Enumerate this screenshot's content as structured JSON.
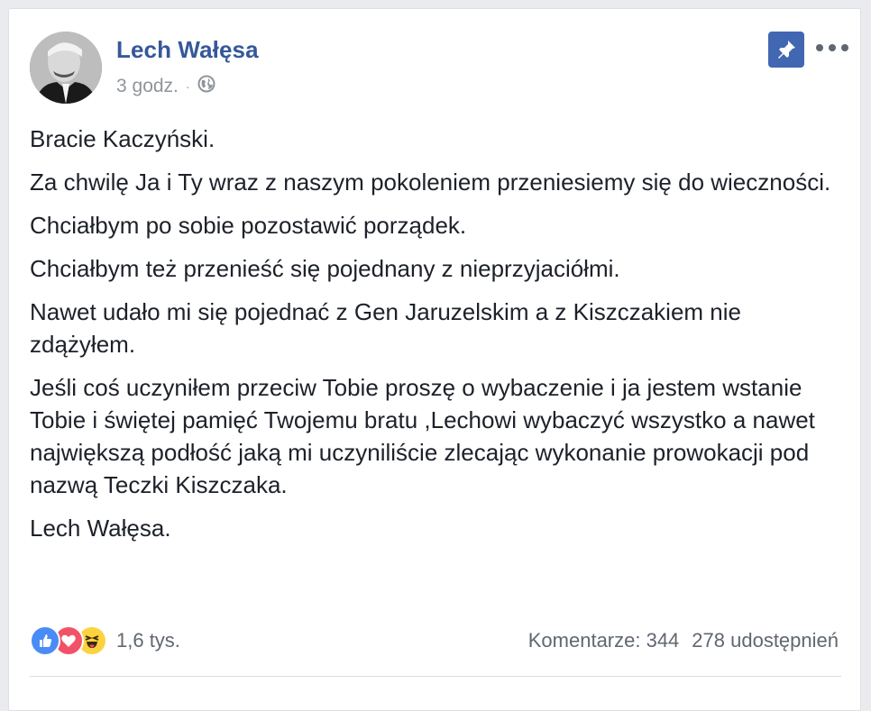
{
  "post": {
    "author_name": "Lech Wałęsa",
    "timestamp": "3 godz.",
    "privacy_separator": "·",
    "privacy_icon": "globe-icon",
    "pin_icon": "pin-icon",
    "more_icon": "more-options-icon",
    "paragraphs": [
      "Bracie Kaczyński.",
      "Za chwilę Ja i Ty wraz z naszym pokoleniem przeniesiemy się do wieczności.",
      "Chciałbym po sobie pozostawić porządek.",
      "Chciałbym też przenieść się pojednany z nieprzyjaciółmi.",
      "Nawet udało mi się pojednać z Gen Jaruzelskim a z Kiszczakiem nie zdążyłem.",
      "Jeśli coś uczyniłem przeciw Tobie proszę o wybaczenie i ja jestem wstanie Tobie i świętej pamięć Twojemu bratu ,Lechowi wybaczyć wszystko a nawet największą podłość jaką mi uczyniliście zlecając wykonanie prowokacji pod nazwą Teczki Kiszczaka.",
      "Lech Wałęsa."
    ]
  },
  "footer": {
    "reaction_icons": [
      "like-reaction-icon",
      "love-reaction-icon",
      "haha-reaction-icon"
    ],
    "reaction_count": "1,6 tys.",
    "comments": "Komentarze: 344",
    "shares": "278 udostępnień"
  },
  "colors": {
    "name_blue": "#365899",
    "pin_blue": "#4267b2",
    "like": "#4a8cf7",
    "love": "#f25268",
    "haha": "#fcd23f"
  }
}
